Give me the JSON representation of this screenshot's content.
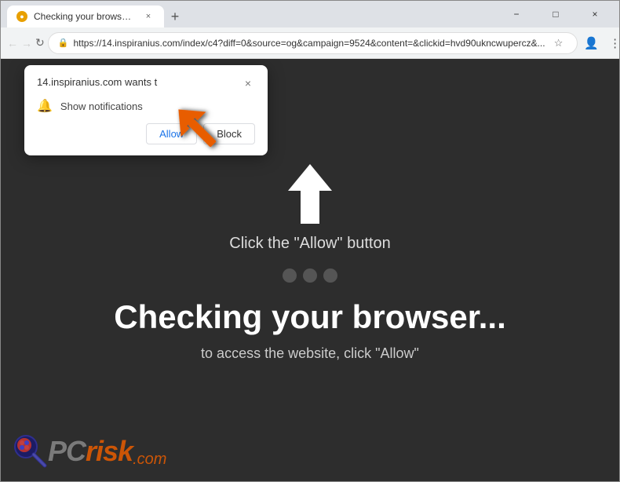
{
  "browser": {
    "tab": {
      "favicon": "●",
      "title": "Checking your browser...",
      "close_label": "×"
    },
    "new_tab_label": "+",
    "window_controls": {
      "minimize": "−",
      "maximize": "□",
      "close": "×"
    },
    "address_bar": {
      "back_label": "←",
      "forward_label": "→",
      "refresh_label": "↻",
      "url": "https://14.inspiranius.com/index/c4?diff=0&source=og&campaign=9524&content=&clickid=hvd90ukncwupercz&...",
      "lock_icon": "🔒",
      "bookmark_label": "☆",
      "profile_label": "👤",
      "menu_label": "⋮"
    }
  },
  "popup": {
    "site_name": "14.inspiranius.com wants t",
    "close_label": "×",
    "permission_text": "Show notifications",
    "allow_label": "Allow",
    "block_label": "Block"
  },
  "page": {
    "click_instruction": "Click the \"Allow\" button",
    "checking_text": "Checking your browser...",
    "sub_text": "to access the website, click \"Allow\""
  },
  "watermark": {
    "pc_text": "PC",
    "risk_text": "risk",
    "dotcom": ".com"
  }
}
